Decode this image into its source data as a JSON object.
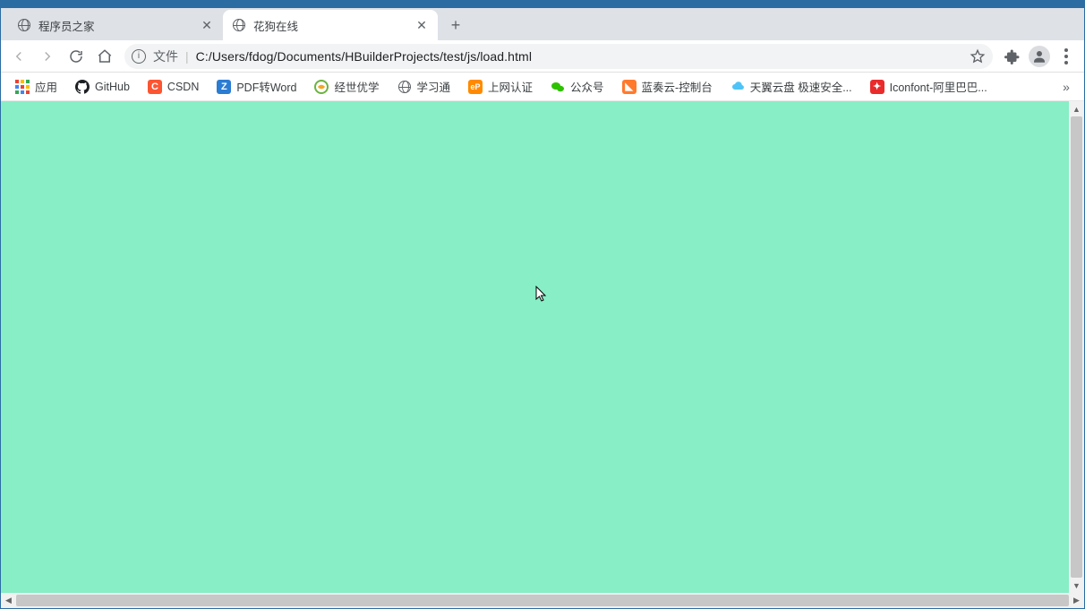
{
  "window_controls": {
    "minimize": "—",
    "maximize": "□",
    "close": "✕"
  },
  "tabs": [
    {
      "title": "程序员之家",
      "active": false
    },
    {
      "title": "花狗在线",
      "active": true
    }
  ],
  "new_tab_glyph": "+",
  "address_bar": {
    "scheme_label": "文件",
    "url": "C:/Users/fdog/Documents/HBuilderProjects/test/js/load.html"
  },
  "bookmarks": [
    {
      "label": "应用",
      "icon": "apps"
    },
    {
      "label": "GitHub",
      "icon": "github"
    },
    {
      "label": "CSDN",
      "icon": "csdn"
    },
    {
      "label": "PDF转Word",
      "icon": "pdfword"
    },
    {
      "label": "经世优学",
      "icon": "jingshi"
    },
    {
      "label": "学习通",
      "icon": "globe"
    },
    {
      "label": "上网认证",
      "icon": "ep"
    },
    {
      "label": "公众号",
      "icon": "gzh"
    },
    {
      "label": "蓝奏云-控制台",
      "icon": "lanzou"
    },
    {
      "label": "天翼云盘 极速安全...",
      "icon": "tianyi"
    },
    {
      "label": "Iconfont-阿里巴巴...",
      "icon": "iconfont"
    }
  ],
  "overflow_glyph": "»",
  "page": {
    "background_color": "#87eec6"
  }
}
